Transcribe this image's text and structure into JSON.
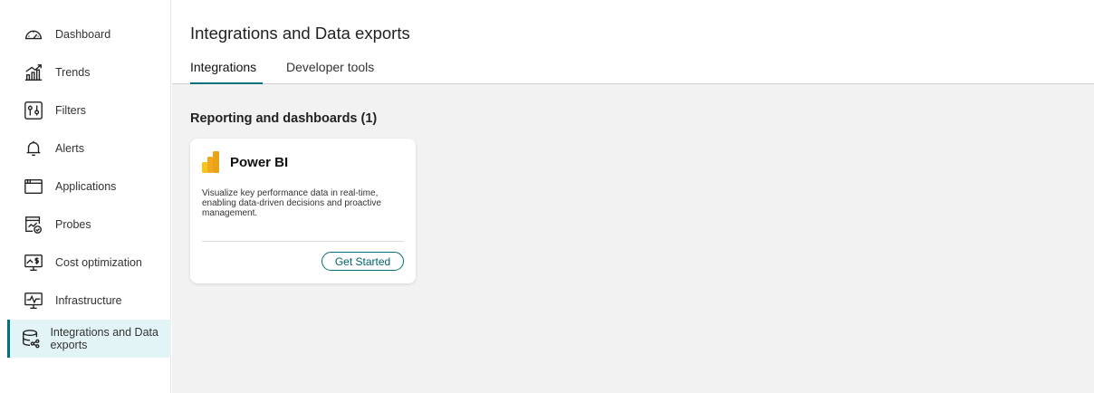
{
  "sidebar": {
    "items": [
      {
        "label": "Dashboard",
        "icon": "speedometer-icon"
      },
      {
        "label": "Trends",
        "icon": "trend-chart-icon"
      },
      {
        "label": "Filters",
        "icon": "filter-sliders-icon"
      },
      {
        "label": "Alerts",
        "icon": "bell-icon"
      },
      {
        "label": "Applications",
        "icon": "window-icon"
      },
      {
        "label": "Probes",
        "icon": "probe-check-icon"
      },
      {
        "label": "Cost optimization",
        "icon": "monitor-dollar-icon"
      },
      {
        "label": "Infrastructure",
        "icon": "monitor-pulse-icon"
      },
      {
        "label": "Integrations and Data exports",
        "icon": "database-share-icon",
        "active": true
      }
    ]
  },
  "header": {
    "title": "Integrations and Data exports"
  },
  "tabs": [
    {
      "label": "Integrations",
      "active": true
    },
    {
      "label": "Developer tools",
      "active": false
    }
  ],
  "main": {
    "section_title": "Reporting and dashboards (1)",
    "cards": [
      {
        "title": "Power BI",
        "logo": "power-bi-logo",
        "description": "Visualize key performance data in real-time, enabling data-driven decisions and proactive management.",
        "button_label": "Get Started"
      }
    ]
  },
  "colors": {
    "accent": "#00707a",
    "active_bg": "#e3f4f6",
    "content_bg": "#f2f2f2"
  }
}
